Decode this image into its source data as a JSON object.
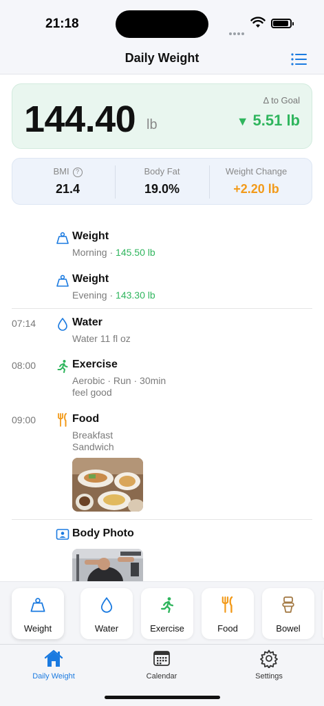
{
  "status": {
    "time": "21:18"
  },
  "nav": {
    "title": "Daily Weight"
  },
  "weight_card": {
    "value": "144.40",
    "unit": "lb",
    "goal_label": "Δ to Goal",
    "goal_value": "5.51 lb",
    "goal_color": "#2fb55d"
  },
  "stats": {
    "bmi_label": "BMI",
    "bmi_value": "21.4",
    "fat_label": "Body Fat",
    "fat_value": "19.0%",
    "change_label": "Weight Change",
    "change_value": "+2.20 lb"
  },
  "entries": [
    {
      "time": "",
      "title": "Weight",
      "sub_prefix": "Morning · ",
      "sub_value": "145.50 lb",
      "icon": "scale-icon"
    },
    {
      "time": "",
      "title": "Weight",
      "sub_prefix": "Evening · ",
      "sub_value": "143.30 lb",
      "icon": "scale-icon"
    },
    {
      "time": "07:14",
      "title": "Water",
      "sub": "Water 11 fl oz",
      "icon": "drop-icon"
    },
    {
      "time": "08:00",
      "title": "Exercise",
      "sub1": "Aerobic · Run · 30min",
      "sub2": "feel good",
      "icon": "runner-icon"
    },
    {
      "time": "09:00",
      "title": "Food",
      "sub1": "Breakfast",
      "sub2": "Sandwich",
      "icon": "fork-knife-icon"
    },
    {
      "time": "",
      "title": "Body Photo",
      "icon": "person-photo-icon"
    }
  ],
  "quick_add": [
    {
      "label": "Weight",
      "icon": "scale-icon"
    },
    {
      "label": "Water",
      "icon": "drop-icon"
    },
    {
      "label": "Exercise",
      "icon": "runner-icon"
    },
    {
      "label": "Food",
      "icon": "fork-knife-icon"
    },
    {
      "label": "Bowel",
      "icon": "toilet-icon"
    }
  ],
  "tabs": [
    {
      "label": "Daily Weight",
      "icon": "home-icon",
      "active": true
    },
    {
      "label": "Calendar",
      "icon": "calendar-icon",
      "active": false
    },
    {
      "label": "Settings",
      "icon": "gear-icon",
      "active": false
    }
  ],
  "colors": {
    "accent": "#1a7ae0",
    "green": "#2fb55d",
    "orange": "#f29a1a"
  }
}
